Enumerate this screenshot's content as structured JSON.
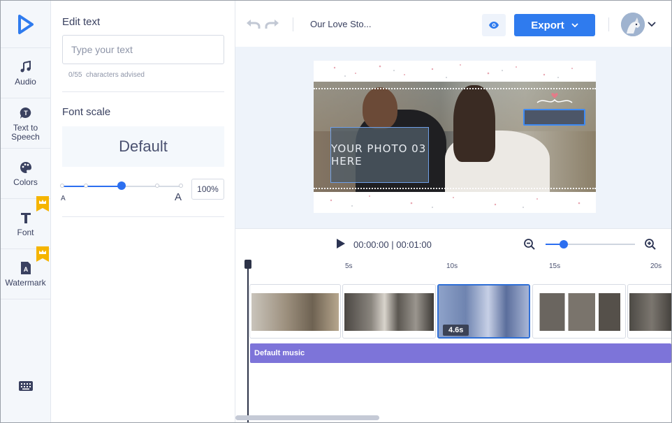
{
  "sidebar": {
    "items": [
      {
        "label": "Audio",
        "icon": "music-note-icon"
      },
      {
        "label": "Text to Speech",
        "icon": "speech-bubble-icon"
      },
      {
        "label": "Colors",
        "icon": "palette-icon"
      },
      {
        "label": "Font",
        "icon": "font-icon",
        "premium": true
      },
      {
        "label": "Watermark",
        "icon": "watermark-icon",
        "premium": true
      }
    ]
  },
  "edit_panel": {
    "edit_text_heading": "Edit text",
    "text_placeholder": "Type your text",
    "text_value": "",
    "char_count": "0/55",
    "char_hint": "characters advised",
    "font_scale_heading": "Font scale",
    "font_scale_preset": "Default",
    "scale_small_label": "A",
    "scale_large_label": "A",
    "scale_percent": "100%"
  },
  "topbar": {
    "project_title": "Our Love Sto...",
    "export_label": "Export"
  },
  "canvas": {
    "placeholder_text": "YOUR PHOTO 03 HERE"
  },
  "player": {
    "current_time": "00:00:00",
    "separator": "|",
    "total_time": "00:01:00"
  },
  "timeline": {
    "ruler": [
      "5s",
      "10s",
      "15s",
      "20s"
    ],
    "selected_clip_duration": "4.6s",
    "audio_track_label": "Default music"
  },
  "colors": {
    "accent": "#2f7bee",
    "music_track": "#7d74d9",
    "selection": "#3e8bf5"
  }
}
